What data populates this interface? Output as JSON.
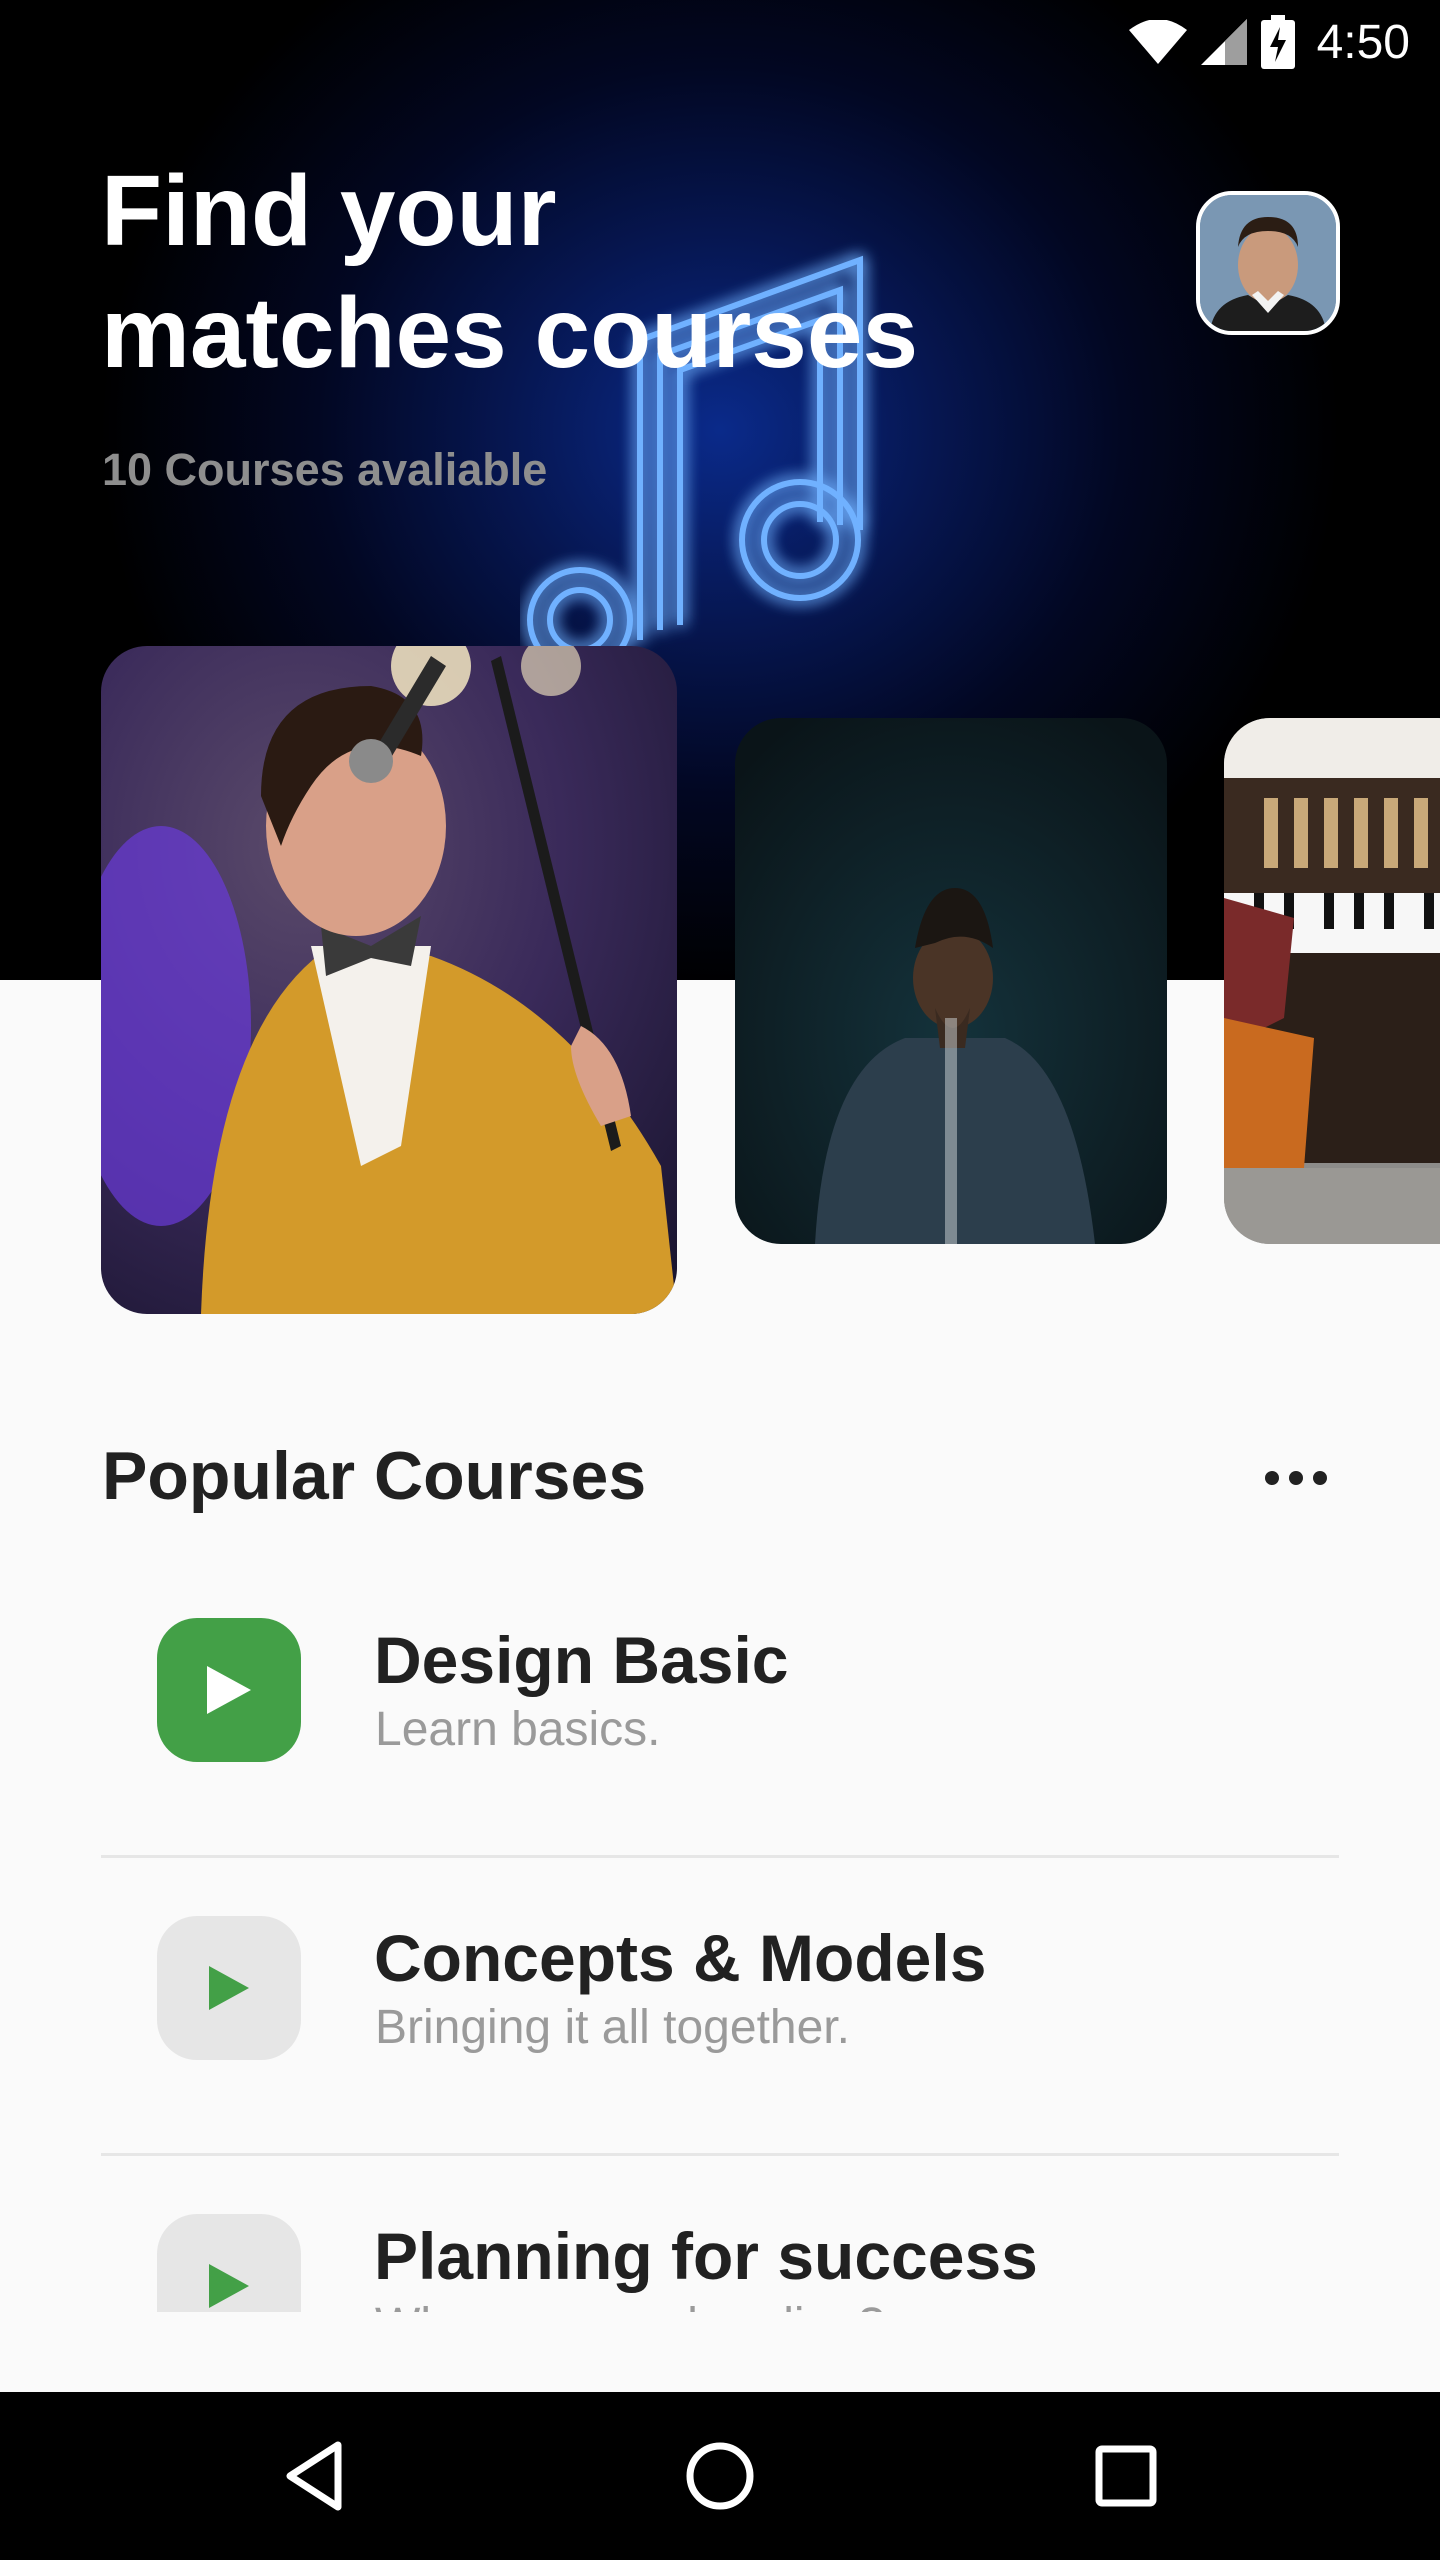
{
  "status_bar": {
    "time": "4:50",
    "icons": [
      "wifi-icon",
      "signal-icon",
      "battery-charging-icon"
    ]
  },
  "header": {
    "title_line1": "Find your",
    "title_line2": "matches courses",
    "subtitle": "10 Courses avaliable"
  },
  "carousel": [
    "singer-photo",
    "rapper-photo",
    "piano-photo"
  ],
  "popular": {
    "title": "Popular Courses",
    "more_icon": "more-horizontal-icon",
    "courses": [
      {
        "title": "Design Basic",
        "subtitle": "Learn basics.",
        "active": true
      },
      {
        "title": "Concepts & Models",
        "subtitle": "Bringing it all together.",
        "active": false
      },
      {
        "title": "Planning for success",
        "subtitle": "Where are we heading?",
        "active": false
      }
    ]
  },
  "nav": [
    "back-icon",
    "home-icon",
    "recents-icon"
  ],
  "colors": {
    "accent": "#43a047",
    "hero": "#000000",
    "neon": "#2f7bff"
  }
}
